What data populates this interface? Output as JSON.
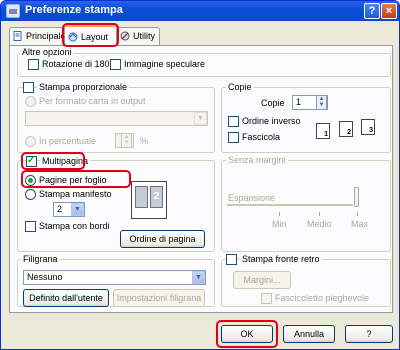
{
  "window": {
    "title": "Preferenze stampa",
    "help_label": "?",
    "close_label": "×"
  },
  "tabs": [
    {
      "label": "Principale"
    },
    {
      "label": "Layout",
      "selected": true
    },
    {
      "label": "Utility"
    }
  ],
  "altre_opzioni": {
    "legend": "Altre opzioni",
    "rotazione": {
      "label": "Rotazione di 180°",
      "checked": false
    },
    "immagine_speculare": {
      "label": "Immagine speculare",
      "checked": false
    }
  },
  "stampa_proporzionale": {
    "label": "Stampa proporzionale",
    "checked": false,
    "per_formato": "Per formato carta in output",
    "in_percentuale": "In percentuale",
    "percent_sign": "%"
  },
  "copie": {
    "legend": "Copie",
    "copie_label": "Copie",
    "copie_value": "1",
    "ordine_inverso": {
      "label": "Ordine inverso",
      "checked": false
    },
    "fascicola": {
      "label": "Fascicola",
      "checked": false
    },
    "collate_icons": [
      "1",
      "2",
      "3"
    ]
  },
  "multipagina": {
    "label": "Multipagina",
    "checked": true,
    "pagine_per_foglio": {
      "label": "Pagine per foglio",
      "selected": true
    },
    "stampa_manifesto": {
      "label": "Stampa manifesto",
      "selected": false
    },
    "pages_value": "2",
    "preview_digit": "2",
    "stampa_con_bordi": {
      "label": "Stampa con bordi",
      "checked": false
    },
    "ordine_di_pagina": "Ordine di pagina"
  },
  "senza_margini": {
    "legend": "Senza margini",
    "espansione": "Espansione",
    "ticks": [
      "Min",
      "Medio",
      "Max"
    ]
  },
  "filigrana": {
    "legend": "Filigrana",
    "selected": "Nessuno",
    "definito_utente": "Definito dall'utente",
    "impostazioni": "Impostazioni filigrana"
  },
  "fronte_retro": {
    "label": "Stampa fronte retro",
    "checked": false,
    "margini": "Margini...",
    "fascicoletto": "Fascicoletto pieghevole"
  },
  "footer": {
    "ok": "OK",
    "annulla": "Annulla",
    "help": "?"
  },
  "colors": {
    "titlebar": "#0a4ed8",
    "highlight": "#e0001a",
    "dialog_bg": "#ece9d8",
    "panel_bg": "#fcfcfe"
  }
}
